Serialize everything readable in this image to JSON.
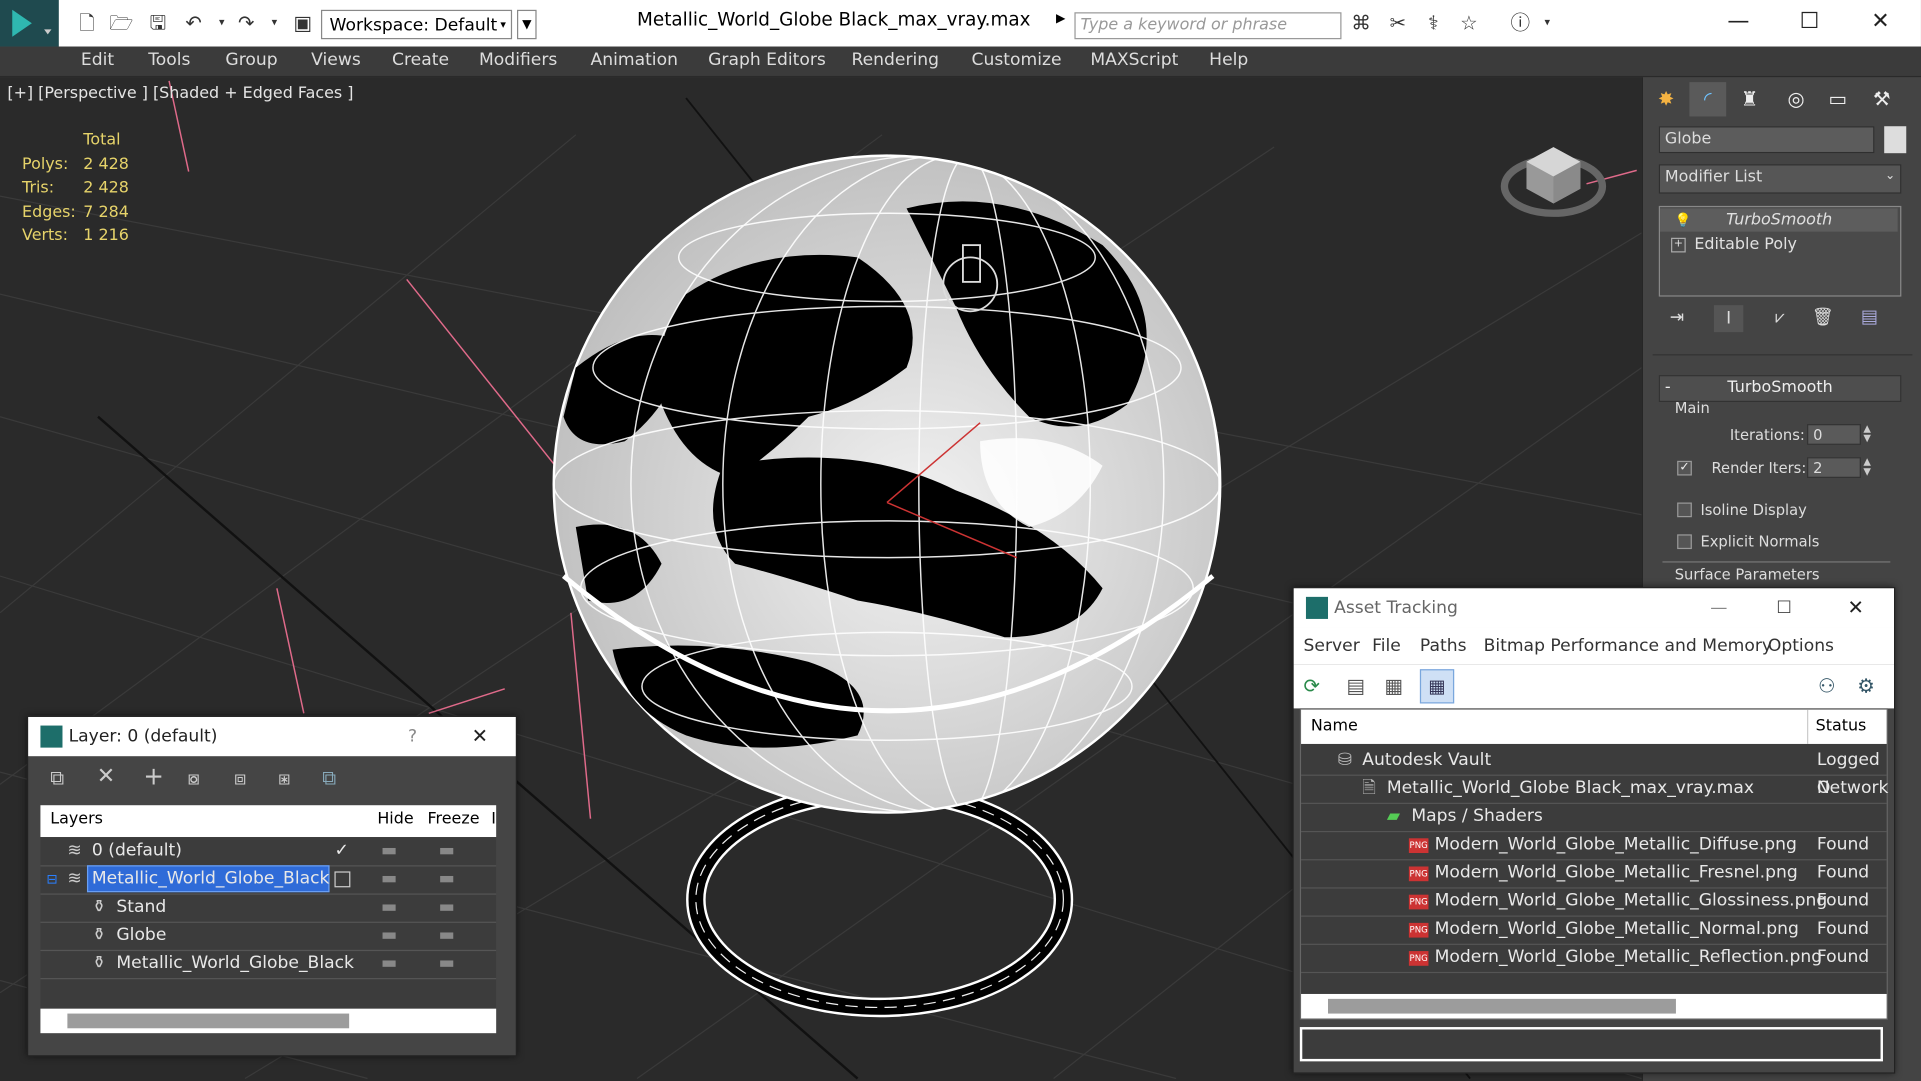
{
  "titlebar": {
    "workspace": "Workspace: Default",
    "document_title": "Metallic_World_Globe Black_max_vray.max",
    "search_placeholder": "Type a keyword or phrase"
  },
  "menu": [
    "Edit",
    "Tools",
    "Group",
    "Views",
    "Create",
    "Modifiers",
    "Animation",
    "Graph Editors",
    "Rendering",
    "Customize",
    "MAXScript",
    "Help"
  ],
  "viewport": {
    "label": "[+] [Perspective ] [Shaded + Edged Faces ]",
    "stats": {
      "header": "Total",
      "rows": [
        {
          "k": "Polys:",
          "v": "2 428"
        },
        {
          "k": "Tris:",
          "v": "2 428"
        },
        {
          "k": "Edges:",
          "v": "7 284"
        },
        {
          "k": "Verts:",
          "v": "1 216"
        }
      ]
    }
  },
  "command_panel": {
    "object_name": "Globe",
    "modifier_list": "Modifier List",
    "stack": [
      "TurboSmooth",
      "Editable Poly"
    ],
    "rollout_title": "TurboSmooth",
    "main_label": "Main",
    "iterations_label": "Iterations:",
    "iterations_value": "0",
    "render_iters_label": "Render Iters:",
    "render_iters_value": "2",
    "isoline_label": "Isoline Display",
    "explicit_normals_label": "Explicit Normals",
    "surface_params_label": "Surface Parameters"
  },
  "layer_window": {
    "title": "Layer: 0 (default)",
    "help": "?",
    "columns": [
      "Layers",
      "Hide",
      "Freeze",
      "I"
    ],
    "rows": [
      {
        "name": "0 (default)"
      },
      {
        "name": "Metallic_World_Globe_Black"
      },
      {
        "name": "Stand"
      },
      {
        "name": "Globe"
      },
      {
        "name": "Metallic_World_Globe_Black"
      }
    ]
  },
  "asset_window": {
    "title": "Asset Tracking",
    "menu": [
      "Server",
      "File",
      "Paths",
      "Bitmap Performance and Memory",
      "Options"
    ],
    "columns": [
      "Name",
      "Status"
    ],
    "png_badge": "PNG",
    "rows": [
      {
        "name": "Autodesk Vault",
        "status": "Logged O"
      },
      {
        "name": "Metallic_World_Globe Black_max_vray.max",
        "status": "Network"
      },
      {
        "name": "Maps / Shaders",
        "status": ""
      },
      {
        "name": "Modern_World_Globe_Metallic_Diffuse.png",
        "status": "Found"
      },
      {
        "name": "Modern_World_Globe_Metallic_Fresnel.png",
        "status": "Found"
      },
      {
        "name": "Modern_World_Globe_Metallic_Glossiness.png",
        "status": "Found"
      },
      {
        "name": "Modern_World_Globe_Metallic_Normal.png",
        "status": "Found"
      },
      {
        "name": "Modern_World_Globe_Metallic_Reflection.png",
        "status": "Found"
      }
    ]
  }
}
